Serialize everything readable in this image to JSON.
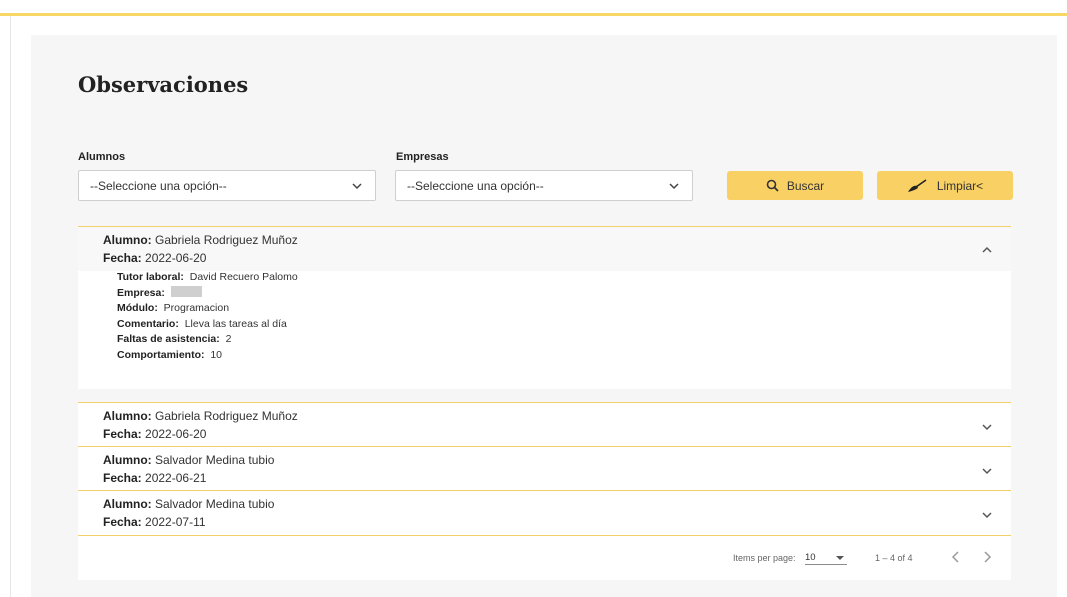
{
  "page": {
    "title": "Observaciones"
  },
  "filters": {
    "alumnos": {
      "label": "Alumnos",
      "value": "--Seleccione una opción--"
    },
    "empresas": {
      "label": "Empresas",
      "value": "--Seleccione una opción--"
    },
    "buscar_label": "Buscar",
    "limpiar_label": "Limpiar<"
  },
  "observations": [
    {
      "alumno_label": "Alumno:",
      "alumno": "Gabriela Rodriguez Muñoz",
      "fecha_label": "Fecha:",
      "fecha": "2022-06-20",
      "expanded": true,
      "details": {
        "tutor_label": "Tutor laboral:",
        "tutor": "David Recuero Palomo",
        "empresa_label": "Empresa:",
        "modulo_label": "Módulo:",
        "modulo": "Programacion",
        "comentario_label": "Comentario:",
        "comentario": "Lleva las tareas al día",
        "faltas_label": "Faltas de asistencia:",
        "faltas": "2",
        "comportamiento_label": "Comportamiento:",
        "comportamiento": "10"
      }
    },
    {
      "alumno_label": "Alumno:",
      "alumno": "Gabriela Rodriguez Muñoz",
      "fecha_label": "Fecha:",
      "fecha": "2022-06-20",
      "expanded": false
    },
    {
      "alumno_label": "Alumno:",
      "alumno": "Salvador Medina tubio",
      "fecha_label": "Fecha:",
      "fecha": "2022-06-21",
      "expanded": false
    },
    {
      "alumno_label": "Alumno:",
      "alumno": "Salvador Medina tubio",
      "fecha_label": "Fecha:",
      "fecha": "2022-07-11",
      "expanded": false
    }
  ],
  "paginator": {
    "items_per_page_label": "Items per page:",
    "page_size": "10",
    "range": "1 – 4 of 4"
  },
  "colors": {
    "accent": "#f8d063",
    "accent_line": "#f2d16b",
    "panel": "#f6f6f6"
  },
  "icons": [
    "search-icon",
    "broom-icon",
    "chevron-down-icon",
    "chevron-up-icon",
    "chevron-left-icon",
    "chevron-right-icon"
  ]
}
